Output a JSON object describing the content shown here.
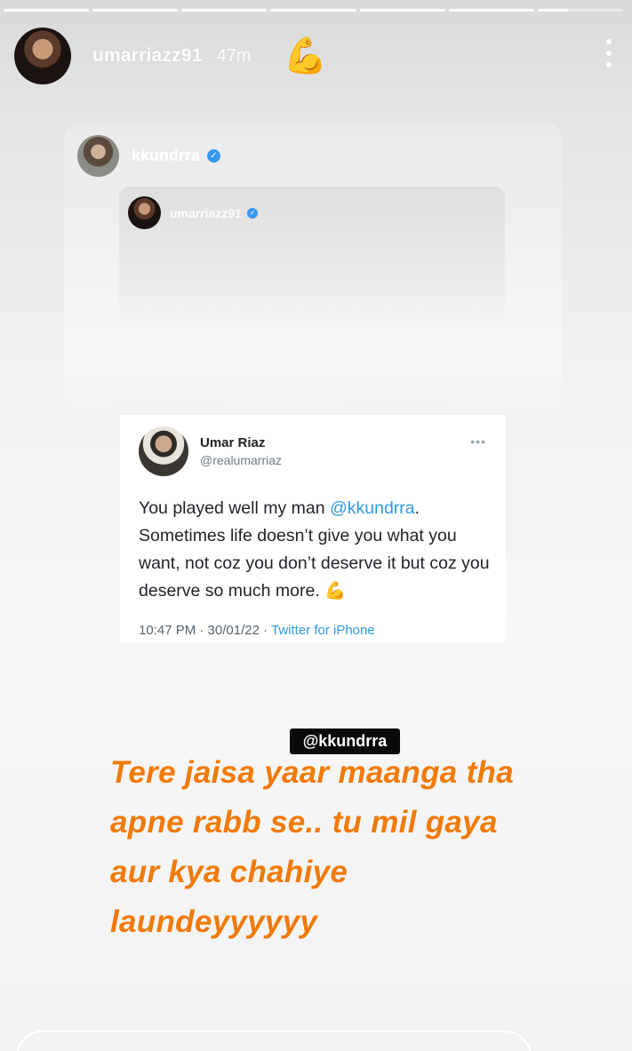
{
  "story": {
    "progress_segments": 7,
    "active_segment": 7
  },
  "header": {
    "username": "umarriazz91",
    "time_ago": "47m",
    "emoji": "💪"
  },
  "shared_post": {
    "handle": "kkundrra",
    "verified_glyph": "✓",
    "nested_post": {
      "handle": "umarriazz91",
      "verified_glyph": "✓"
    }
  },
  "tweet": {
    "name": "Umar Riaz",
    "handle": "@realumarriaz",
    "more": "•••",
    "text_before": "You played well my man ",
    "mention": "@kkundrra",
    "text_after": ". Sometimes life doesn’t give you what you want, not coz you don’t deserve it but coz you deserve so much more. ",
    "emoji": "💪",
    "timestamp": "10:47 PM · 30/01/22 · ",
    "source": "Twitter for iPhone"
  },
  "mention_sticker": "@kkundrra",
  "caption": "Tere jaisa yaar maanga tha apne rabb se.. tu mil gaya aur kya chahiye laundeyyyyyy"
}
